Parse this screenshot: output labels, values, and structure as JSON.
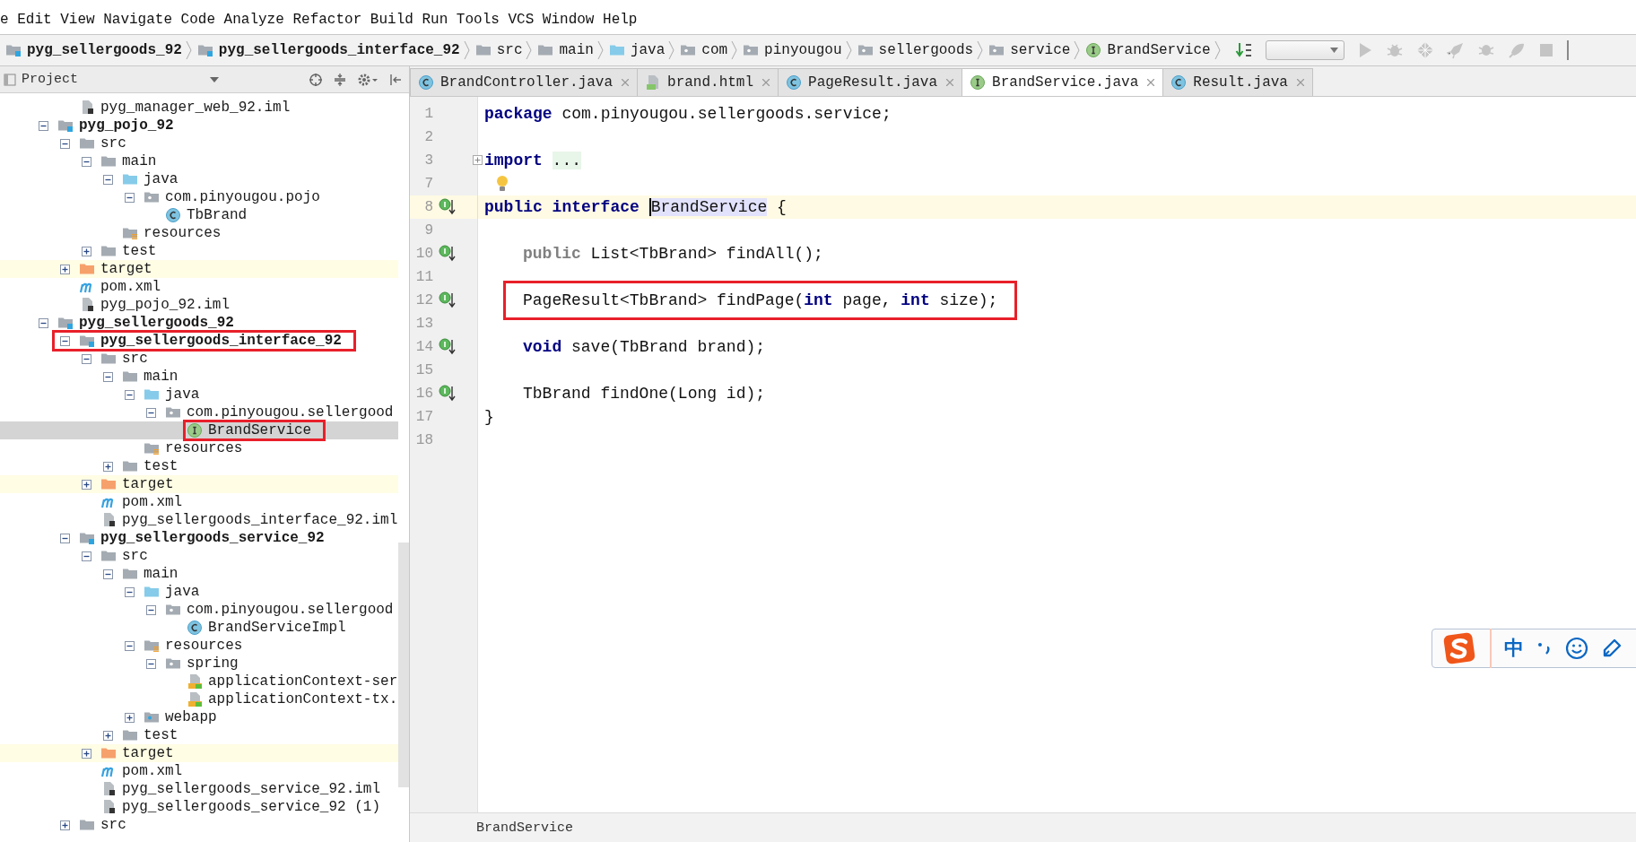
{
  "menu": [
    "e",
    "Edit",
    "View",
    "Navigate",
    "Code",
    "Analyze",
    "Refactor",
    "Build",
    "Run",
    "Tools",
    "VCS",
    "Window",
    "Help"
  ],
  "breadcrumbs": [
    {
      "label": "pyg_sellergoods_92",
      "kind": "module"
    },
    {
      "label": "pyg_sellergoods_interface_92",
      "kind": "module"
    },
    {
      "label": "src",
      "kind": "folder"
    },
    {
      "label": "main",
      "kind": "folder"
    },
    {
      "label": "java",
      "kind": "source"
    },
    {
      "label": "com",
      "kind": "package"
    },
    {
      "label": "pinyougou",
      "kind": "package"
    },
    {
      "label": "sellergoods",
      "kind": "package"
    },
    {
      "label": "service",
      "kind": "package"
    },
    {
      "label": "BrandService",
      "kind": "interface"
    }
  ],
  "project_panel": {
    "title": "Project"
  },
  "tree": {
    "continued": [
      {
        "label": "pyg_manager_web_92.iml",
        "kind": "iml",
        "selected": false
      }
    ],
    "items": [
      {
        "label": "pyg_pojo_92",
        "kind": "module",
        "selected": false,
        "expanded": true,
        "children": [
          {
            "label": "src",
            "kind": "folder",
            "selected": false,
            "expanded": true,
            "children": [
              {
                "label": "main",
                "kind": "folder",
                "selected": false,
                "expanded": true,
                "children": [
                  {
                    "label": "java",
                    "kind": "source",
                    "selected": false,
                    "expanded": true,
                    "children": [
                      {
                        "label": "com.pinyougou.pojo",
                        "kind": "package",
                        "selected": false,
                        "expanded": true,
                        "children": [
                          {
                            "label": "TbBrand",
                            "kind": "class",
                            "selected": false
                          }
                        ]
                      }
                    ]
                  },
                  {
                    "label": "resources",
                    "kind": "resources",
                    "selected": false
                  }
                ]
              },
              {
                "label": "test",
                "kind": "folder",
                "selected": false,
                "expanded": false
              }
            ]
          },
          {
            "label": "target",
            "kind": "excluded",
            "selected": false,
            "expanded": false
          },
          {
            "label": "pom.xml",
            "kind": "maven",
            "selected": false
          },
          {
            "label": "pyg_pojo_92.iml",
            "kind": "iml",
            "selected": false
          }
        ]
      },
      {
        "label": "pyg_sellergoods_92",
        "kind": "module",
        "selected": false,
        "expanded": true,
        "children": [
          {
            "label": "pyg_sellergoods_interface_92",
            "kind": "module",
            "selected": false,
            "boxed": true,
            "expanded": true,
            "children": [
              {
                "label": "src",
                "kind": "folder",
                "selected": false,
                "expanded": true,
                "children": [
                  {
                    "label": "main",
                    "kind": "folder",
                    "selected": false,
                    "expanded": true,
                    "children": [
                      {
                        "label": "java",
                        "kind": "source",
                        "selected": false,
                        "expanded": true,
                        "children": [
                          {
                            "label": "com.pinyougou.sellergood",
                            "kind": "package",
                            "selected": false,
                            "expanded": true,
                            "children": [
                              {
                                "label": "BrandService",
                                "kind": "interface",
                                "selected": true,
                                "boxed": true
                              }
                            ]
                          }
                        ]
                      },
                      {
                        "label": "resources",
                        "kind": "resources",
                        "selected": false
                      }
                    ]
                  },
                  {
                    "label": "test",
                    "kind": "folder",
                    "selected": false,
                    "expanded": false
                  }
                ]
              },
              {
                "label": "target",
                "kind": "excluded",
                "selected": false,
                "expanded": false
              },
              {
                "label": "pom.xml",
                "kind": "maven",
                "selected": false
              },
              {
                "label": "pyg_sellergoods_interface_92.iml",
                "kind": "iml",
                "selected": false
              }
            ]
          },
          {
            "label": "pyg_sellergoods_service_92",
            "kind": "module",
            "selected": false,
            "expanded": true,
            "children": [
              {
                "label": "src",
                "kind": "folder",
                "selected": false,
                "expanded": true,
                "children": [
                  {
                    "label": "main",
                    "kind": "folder",
                    "selected": false,
                    "expanded": true,
                    "children": [
                      {
                        "label": "java",
                        "kind": "source",
                        "selected": false,
                        "expanded": true,
                        "children": [
                          {
                            "label": "com.pinyougou.sellergood",
                            "kind": "package",
                            "selected": false,
                            "expanded": true,
                            "children": [
                              {
                                "label": "BrandServiceImpl",
                                "kind": "class",
                                "selected": false
                              }
                            ]
                          }
                        ]
                      },
                      {
                        "label": "resources",
                        "kind": "resources",
                        "selected": false,
                        "expanded": true,
                        "children": [
                          {
                            "label": "spring",
                            "kind": "package",
                            "selected": false,
                            "expanded": true,
                            "children": [
                              {
                                "label": "applicationContext-ser",
                                "kind": "xml",
                                "selected": false
                              },
                              {
                                "label": "applicationContext-tx.",
                                "kind": "xml",
                                "selected": false
                              }
                            ]
                          }
                        ]
                      },
                      {
                        "label": "webapp",
                        "kind": "webapp",
                        "selected": false,
                        "expanded": false
                      }
                    ]
                  },
                  {
                    "label": "test",
                    "kind": "folder",
                    "selected": false,
                    "expanded": false
                  }
                ]
              },
              {
                "label": "target",
                "kind": "excluded",
                "selected": false,
                "expanded": false
              },
              {
                "label": "pom.xml",
                "kind": "maven",
                "selected": false
              },
              {
                "label": "pyg_sellergoods_service_92.iml",
                "kind": "iml",
                "selected": false
              },
              {
                "label": "pyg_sellergoods_service_92 (1)",
                "kind": "iml",
                "selected": false
              }
            ]
          },
          {
            "label": "src",
            "kind": "folder",
            "selected": false,
            "expanded": false
          }
        ]
      }
    ]
  },
  "tabs": [
    {
      "label": "BrandController.java",
      "kind": "class",
      "selected": false
    },
    {
      "label": "brand.html",
      "kind": "html",
      "selected": false
    },
    {
      "label": "PageResult.java",
      "kind": "class",
      "selected": false
    },
    {
      "label": "BrandService.java",
      "kind": "interface",
      "selected": true
    },
    {
      "label": "Result.java",
      "kind": "class",
      "selected": false
    }
  ],
  "code": {
    "lines": [
      {
        "number": "1",
        "current": false,
        "implemented": false,
        "indented": false,
        "segments": [
          {
            "kind": "keyword",
            "text": "package"
          },
          {
            "kind": "plain",
            "text": " com.pinyougou.sellergoods.service;"
          }
        ]
      },
      {
        "number": "2",
        "current": false,
        "implemented": false
      },
      {
        "number": "3",
        "current": false,
        "implemented": false,
        "indented": false,
        "segments": [
          {
            "kind": "keyword",
            "text": "import"
          },
          {
            "kind": "folded",
            "text": "..."
          }
        ]
      },
      {
        "number": "7",
        "current": false,
        "implemented": false,
        "segments": [
          {
            "kind": "bulb"
          }
        ]
      },
      {
        "number": "8",
        "current": true,
        "implemented": true,
        "indented": false,
        "segments": [
          {
            "kind": "keyword",
            "text": "public interface"
          },
          {
            "kind": "symbol",
            "text": "BrandService"
          },
          {
            "kind": "plain",
            "text": " {"
          }
        ]
      },
      {
        "number": "9",
        "current": false,
        "implemented": false
      },
      {
        "number": "10",
        "current": false,
        "implemented": true,
        "indented": true,
        "segments": [
          {
            "kind": "muted",
            "text": "public"
          },
          {
            "kind": "plain",
            "text": " List<TbBrand> findAll();"
          }
        ]
      },
      {
        "number": "11",
        "current": false,
        "implemented": false
      },
      {
        "number": "12",
        "current": false,
        "implemented": true,
        "indented": true,
        "boxed": true,
        "segments": [
          {
            "kind": "plain",
            "text": "PageResult<TbBrand> findPage("
          },
          {
            "kind": "keyword",
            "text": "int"
          },
          {
            "kind": "plain",
            "text": " page, "
          },
          {
            "kind": "keyword",
            "text": "int"
          },
          {
            "kind": "plain",
            "text": " size);"
          }
        ]
      },
      {
        "number": "13",
        "current": false,
        "implemented": false
      },
      {
        "number": "14",
        "current": false,
        "implemented": true,
        "indented": true,
        "segments": [
          {
            "kind": "keyword",
            "text": "void"
          },
          {
            "kind": "plain",
            "text": " save(TbBrand brand);"
          }
        ]
      },
      {
        "number": "15",
        "current": false,
        "implemented": false
      },
      {
        "number": "16",
        "current": false,
        "implemented": true,
        "indented": true,
        "segments": [
          {
            "kind": "plain",
            "text": "TbBrand findOne(Long id);"
          }
        ]
      },
      {
        "number": "17",
        "current": false,
        "implemented": false,
        "indented": false,
        "segments": [
          {
            "kind": "plain",
            "text": "}"
          }
        ]
      },
      {
        "number": "18",
        "current": false,
        "implemented": false
      }
    ]
  },
  "editor_footer": "BrandService",
  "ime_bar": {
    "mode": "中"
  }
}
